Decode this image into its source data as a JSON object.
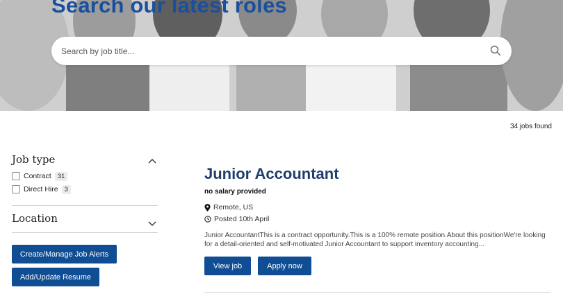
{
  "hero": {
    "title": "Search our latest roles",
    "search_placeholder": "Search by job title..."
  },
  "results": {
    "jobs_found": "34 jobs found"
  },
  "filters": {
    "job_type": {
      "title": "Job type",
      "expanded": true,
      "options": [
        {
          "label": "Contract",
          "count": "31",
          "checked": false
        },
        {
          "label": "Direct Hire",
          "count": "3",
          "checked": false
        }
      ]
    },
    "location": {
      "title": "Location",
      "expanded": false
    }
  },
  "actions": {
    "job_alerts_label": "Create/Manage Job Alerts",
    "resume_label": "Add/Update Resume"
  },
  "job": {
    "title": "Junior Accountant",
    "salary": "no salary provided",
    "location": "Remote, US",
    "posted": "Posted 10th April",
    "description": "Junior AccountantThis is a contract opportunity.This is a 100% remote position.About this positionWe're looking for a detail-oriented and self-motivated Junior Accountant to support inventory accounting...",
    "view_label": "View job",
    "apply_label": "Apply now"
  },
  "colors": {
    "primary_button": "#0f4d94",
    "hero_title": "#1a4f9c",
    "job_title": "#1f3e6e"
  },
  "icons": [
    "search-icon",
    "chevron-up-icon",
    "chevron-down-icon",
    "map-pin-icon",
    "clock-icon"
  ]
}
